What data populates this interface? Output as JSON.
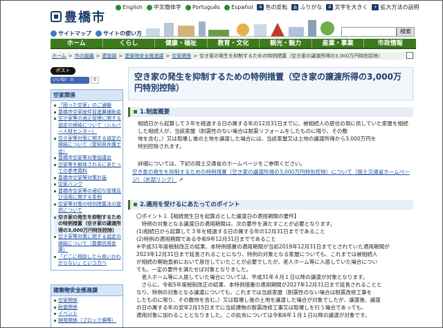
{
  "header": {
    "logo_text": "豊橋市",
    "util_links": [
      "English",
      "中文簡体字",
      "Português",
      "Español",
      "色の反転",
      "ふりがな",
      "文字を大きく",
      "拡大方法の説明"
    ],
    "sub_links": [
      "サイトマップ",
      "サイトの使い方"
    ],
    "search_button": "検索",
    "search_value": ""
  },
  "nav": [
    "ホーム",
    "くらし",
    "健康・福祉",
    "教育・文化",
    "観光・魅力",
    "産業・事業",
    "市政情報"
  ],
  "breadcrumb": [
    "ホーム",
    "市の組織",
    "建設部",
    "建築物安全推進課",
    "空家関係",
    "空き家の発生を抑制するための特例措置（空き家の譲渡所得の3,000万円特別控除）"
  ],
  "social": {
    "post": "ポスト",
    "like": "いいね！ 0",
    "count": "0"
  },
  "sidebar": {
    "box1": {
      "title": "空家関係",
      "items": [
        "「困った空家」のご通報",
        "豊橋市空家総件促進費補助金",
        "空き家等の適正管理に関する協定の締結について（シルバー人材センター）",
        "空き家等対策に関する協定の締結について（愛知県弁護士会）",
        "豊橋市空家等対策協議会",
        "空家等を解体されるにあたっての参考資料",
        "豊橋市空家等対策計画",
        "空家バンク",
        "豊橋市空家等の適切な管理及び活用に関する条例",
        "空家等対策の特別措置法の提供について",
        "空き家の発生を抑制するための特例措置（空き家の譲渡所得の3,000万円特別控除）",
        "空き家等対策に関する協定の締結について（豊橋信用金庫）",
        "「どこに相談したら良いかわからない」という方へ"
      ]
    },
    "box2": {
      "title": "建築物安全推進課",
      "items": [
        "空家関係",
        "耐震関係",
        "イベント",
        "開発関係（ブロック塀等）"
      ]
    }
  },
  "main": {
    "title_line1": "空き家の発生を抑制するための特例措置（空き家の譲渡所得の3,000万",
    "title_line2": "円特別控除）",
    "s1_heading": "1.制度概要",
    "s1_lines": [
      "相続日から起算して３年を経過する日の属する年の12月31日までに、被相続人の居住の用に供していた家屋を相続した相続人が、当該家屋（耐震性のない場合は耐震リフォームをしたものに限り、その敷",
      "地を含む。）又は取壊し後の土地を譲渡した場合には、当該家屋又は土地の譲渡所得から3,000万円を",
      "特別控除されます。"
    ],
    "s1_detail": "詳細については、下記の国土交通省のホームページをご参照ください。",
    "s1_link": "空き家の発生を抑制するための特例措置（空き家の譲渡所得の3,000万円特別控除）について（国土交通省ホームページ）（外部リンク）",
    "s2_heading": "2.適用を受けるにあたってのポイント",
    "s2_lines": [
      "〇ポイント１【相続発生日を起算点とした譲渡日の適用期間の要件】",
      "　特例の対象となる譲渡日の適用期間は、次の要件を満たすことが必要となります。",
      "(1)相続日から起算して３年を経過する日の属する年の12月31日までであること",
      "(2)特例の適用期間である令和9年12月31日までであること",
      "※平成31年度税制改正の結果、本特例措置の適用期間が当初2019年12月31日までとされていた適用期間が",
      "2023年12月31日まで延長されることになり、特例の対象となる家屋についても、これまでは被相続人",
      "が相続の開始直前において居住していたことが必要でしたが、老人ホーム等に入居していた場合につい",
      "ても、一定の要件を満たせば対象となりました。",
      "　老人ホーム等に入居していた場合については、平成31年４月１日以降の譲渡が対象となります。",
      "　さらに、令和5年度税制改正の結果、本特例措置の適用期間が2027年12月31日まで延長されることと",
      "なり、特例の対象となる譲渡についても、これまでは当該家屋（耐震性のない場合は耐震改修工事を",
      "したものに限り、その敷地を含む。）又は取壊し後の土地を譲渡した場合が対象でしたが、譲渡後、譲渡",
      "の日の属する年の翌年2月15日までに当該建物の耐震改修工事又は取壊しを行う場合であっても、",
      "適用対象に加わることとなりました。この拡充については令和6年１月１日以降の譲渡が対象です。"
    ]
  }
}
